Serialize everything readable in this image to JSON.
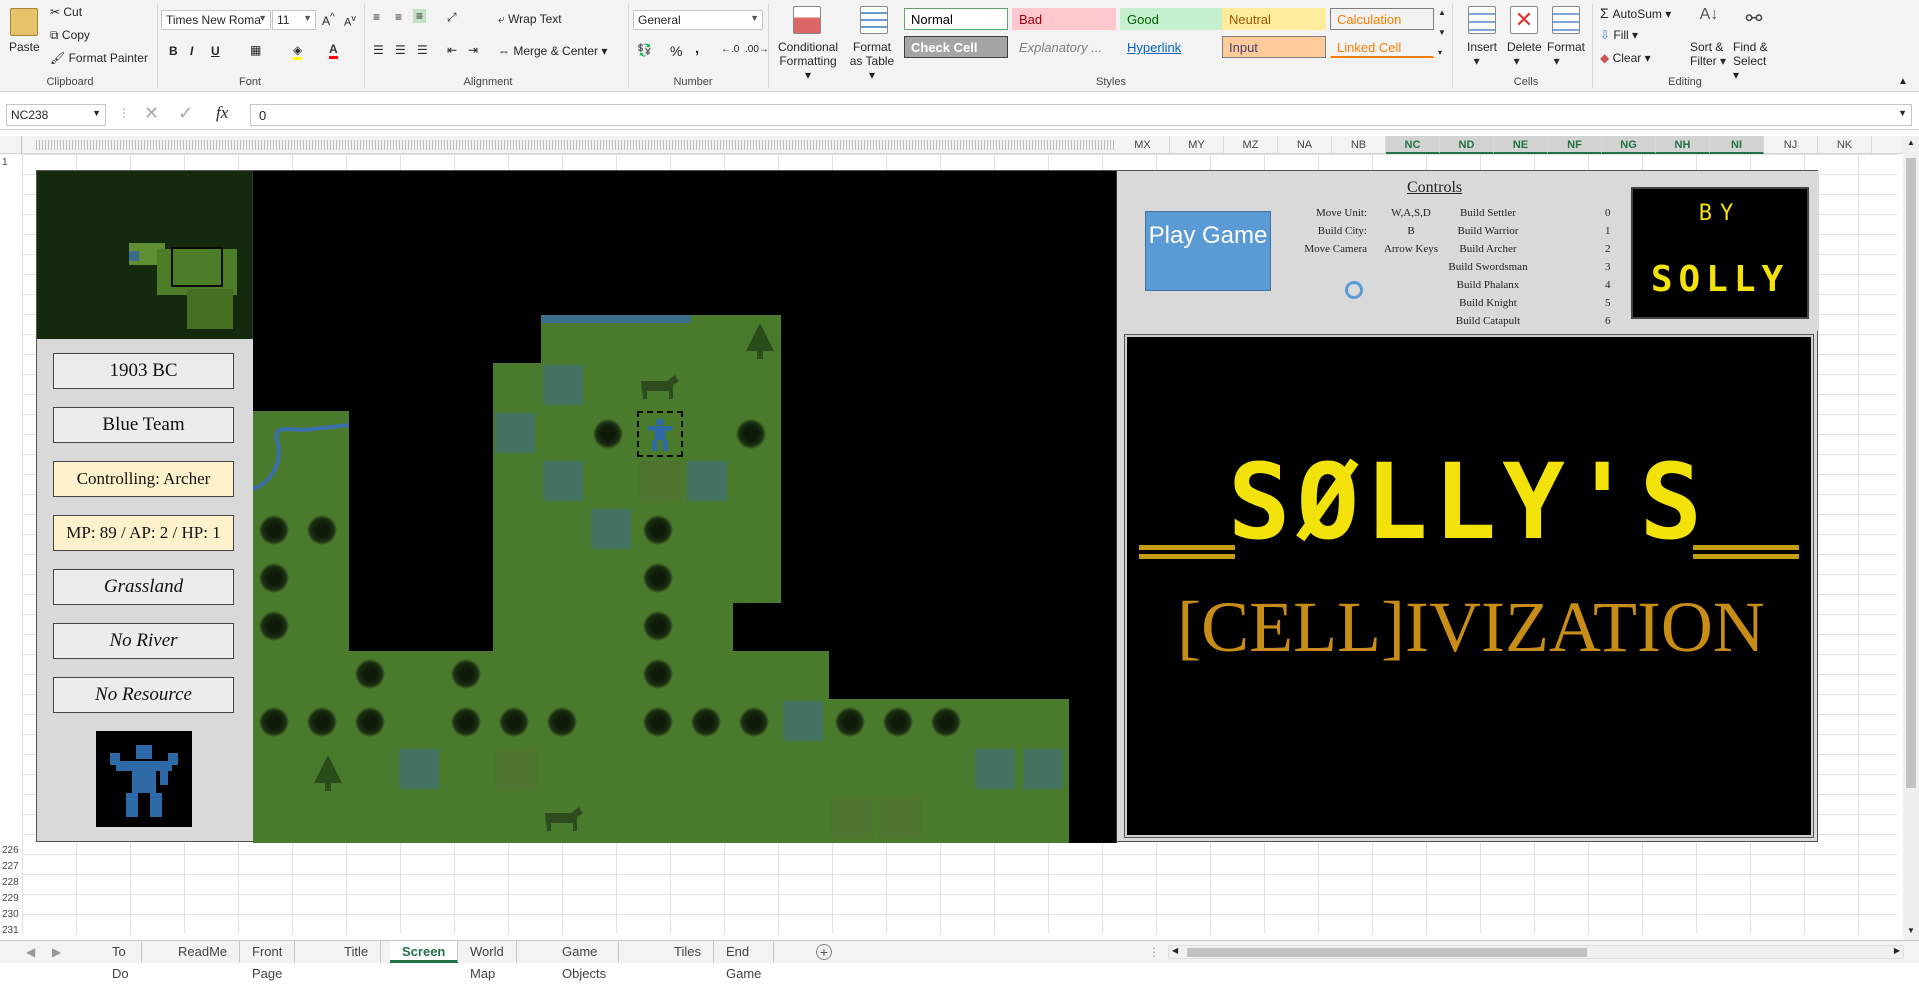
{
  "ribbon": {
    "clipboard": {
      "paste": "Paste",
      "cut": "Cut",
      "copy": "Copy",
      "format_painter": "Format Painter",
      "label": "Clipboard"
    },
    "font": {
      "name": "Times New Roma",
      "size": "11",
      "label": "Font",
      "bold": "B",
      "italic": "I",
      "underline": "U"
    },
    "alignment": {
      "wrap_text": "Wrap Text",
      "merge_center": "Merge & Center",
      "label": "Alignment"
    },
    "number": {
      "format": "General",
      "label": "Number",
      "percent": "%",
      "comma": ","
    },
    "styles": {
      "conditional_formatting": "Conditional Formatting",
      "format_as_table": "Format as Table",
      "label": "Styles",
      "cells": [
        {
          "text": "Normal",
          "bg": "#ffffff",
          "fg": "#000000",
          "border": "#5fa56a"
        },
        {
          "text": "Bad",
          "bg": "#ffc7ce",
          "fg": "#9c0006",
          "border": "#ffc7ce"
        },
        {
          "text": "Good",
          "bg": "#c6efce",
          "fg": "#006100",
          "border": "#c6efce"
        },
        {
          "text": "Neutral",
          "bg": "#ffeb9c",
          "fg": "#9c5700",
          "border": "#ffeb9c"
        },
        {
          "text": "Calculation",
          "bg": "#f2f2f2",
          "fg": "#fa7d00",
          "border": "#7f7f7f"
        },
        {
          "text": "Check Cell",
          "bg": "#a5a5a5",
          "fg": "#ffffff",
          "border": "#3f3f3f"
        },
        {
          "text": "Explanatory ...",
          "bg": "#f3f3f3",
          "fg": "#7f7f7f",
          "border": "#f3f3f3"
        },
        {
          "text": "Hyperlink",
          "bg": "#f3f3f3",
          "fg": "#0563c1",
          "border": "#f3f3f3"
        },
        {
          "text": "Input",
          "bg": "#ffcc99",
          "fg": "#3f3f76",
          "border": "#7f7f7f"
        },
        {
          "text": "Linked Cell",
          "bg": "#f3f3f3",
          "fg": "#fa7d00",
          "border": "#f3f3f3"
        }
      ]
    },
    "cells": {
      "insert": "Insert",
      "delete": "Delete",
      "format": "Format",
      "label": "Cells"
    },
    "editing": {
      "autosum": "AutoSum",
      "fill": "Fill",
      "clear": "Clear",
      "sort_filter": "Sort & Filter",
      "find_select": "Find & Select",
      "label": "Editing"
    }
  },
  "formula_bar": {
    "name_box": "NC238",
    "value": "0"
  },
  "columns": [
    "MX",
    "MY",
    "MZ",
    "NA",
    "NB",
    "NC",
    "ND",
    "NE",
    "NF",
    "NG",
    "NH",
    "NI",
    "NJ",
    "NK"
  ],
  "selected_columns": [
    "NC",
    "ND",
    "NE",
    "NF",
    "NG",
    "NH",
    "NI"
  ],
  "rows_top": [
    "1"
  ],
  "rows_bottom": [
    "226",
    "227",
    "228",
    "229",
    "230",
    "231"
  ],
  "info_panel": {
    "year": "1903 BC",
    "team": "Blue Team",
    "controlling": "Controlling: Archer",
    "stats": "MP: 89 / AP: 2 / HP: 1",
    "terrain": "Grassland",
    "river": "No River",
    "resource": "No Resource"
  },
  "controls": {
    "title": "Controls",
    "play_button": "Play Game",
    "moves": [
      {
        "action": "Move Unit:",
        "key": "W,A,S,D"
      },
      {
        "action": "Build City:",
        "key": "B"
      },
      {
        "action": "Move Camera",
        "key": "Arrow Keys"
      }
    ],
    "builds": [
      {
        "action": "Build Settler",
        "key": "0"
      },
      {
        "action": "Build Warrior",
        "key": "1"
      },
      {
        "action": "Build Archer",
        "key": "2"
      },
      {
        "action": "Build Swordsman",
        "key": "3"
      },
      {
        "action": "Build Phalanx",
        "key": "4"
      },
      {
        "action": "Build Knight",
        "key": "5"
      },
      {
        "action": "Build Catapult",
        "key": "6"
      }
    ],
    "by_label": "BY",
    "author": "SOLLY"
  },
  "title_screen": {
    "main": "SØLLY'S",
    "sub": "[CELL]IVIZATION",
    "title_color": "#f2e20a",
    "sub_color": "#c88d16"
  },
  "sheet_tabs": [
    "To Do",
    "ReadMe",
    "Front Page",
    "Title",
    "Screen",
    "World Map",
    "Game Objects",
    "Tiles",
    "End Game"
  ],
  "active_tab": "Screen",
  "icons": {
    "name_box_dropdown": "chevron-down-icon",
    "cancel": "close-icon",
    "enter": "check-icon",
    "function": "fx-icon",
    "add_sheet": "plus-icon",
    "loading": "spinner-icon"
  }
}
